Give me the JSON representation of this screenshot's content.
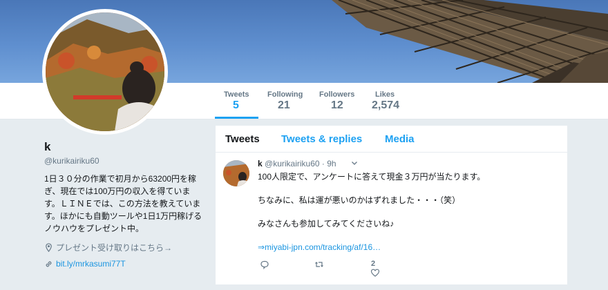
{
  "profile": {
    "name": "k",
    "handle": "@kurikairiku60",
    "bio": "1日３０分の作業で初月から63200円を稼ぎ、現在では100万円の収入を得ています。ＬＩＮＥでは、この方法を教えています。ほかにも自動ツールや1日1万円稼げるノウハウをプレゼント中。",
    "location": "プレゼント受け取りはこちら→",
    "url": "bit.ly/mrkasumi77T"
  },
  "stats": [
    {
      "label": "Tweets",
      "value": "5"
    },
    {
      "label": "Following",
      "value": "21"
    },
    {
      "label": "Followers",
      "value": "12"
    },
    {
      "label": "Likes",
      "value": "2,574"
    }
  ],
  "tabs": [
    "Tweets",
    "Tweets & replies",
    "Media"
  ],
  "tweet": {
    "name": "k",
    "handle": "@kurikairiku60",
    "time": "· 9h",
    "lines": [
      "100人限定で、アンケートに答えて現金３万円が当たります。",
      "ちなみに、私は運が悪いのかはずれました・・・（笑）",
      "みなさんも参加してみてくださいね♪"
    ],
    "link": "⇒miyabi-jpn.com/tracking/af/16…",
    "retweet_count": "",
    "like_count": "2"
  },
  "icons": {
    "location": "location-pin-icon",
    "url": "link-icon",
    "reply": "reply-icon",
    "retweet": "retweet-icon",
    "like": "heart-icon",
    "caret": "chevron-down-icon"
  },
  "colors": {
    "accent": "#1da1f2",
    "link": "#1b95e0",
    "muted": "#657786",
    "page_bg": "#e6ecf0"
  }
}
